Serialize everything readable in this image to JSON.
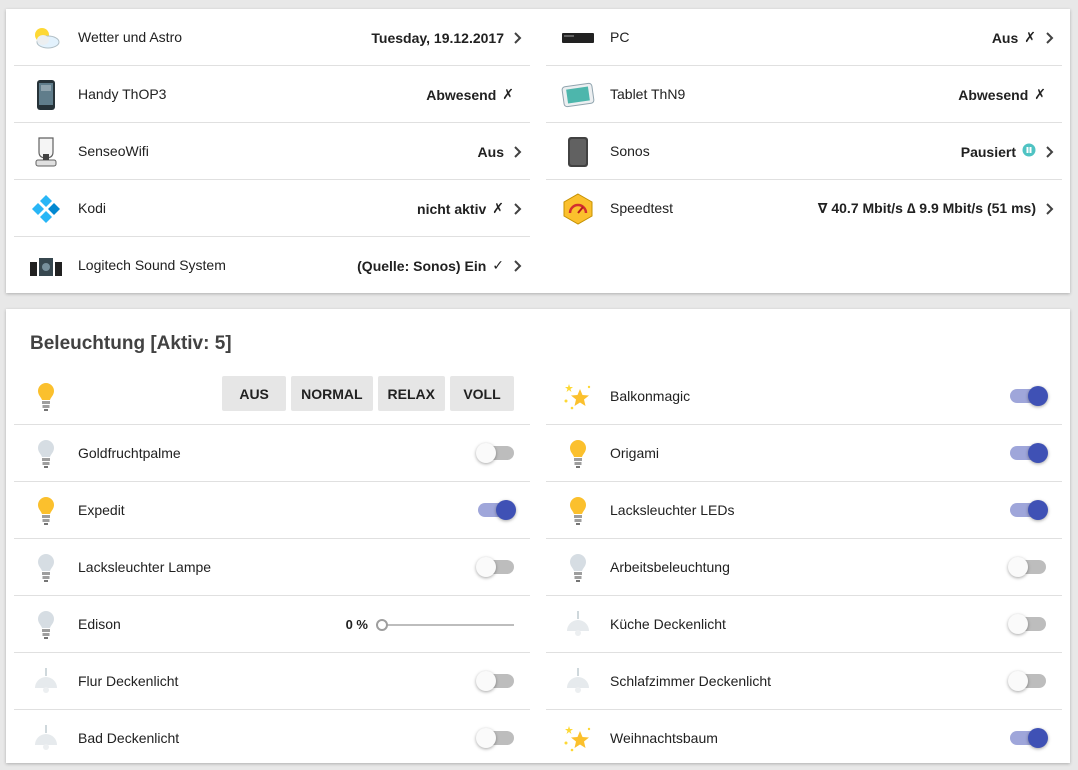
{
  "devices": {
    "left": [
      {
        "name": "Wetter und Astro",
        "value": "Tuesday, 19.12.2017",
        "symbol": "",
        "chevron": true,
        "icon": "weather-icon"
      },
      {
        "name": "Handy ThOP3",
        "value": "Abwesend",
        "symbol": "✗",
        "chevron": false,
        "icon": "phone-icon"
      },
      {
        "name": "SenseoWifi",
        "value": "Aus",
        "symbol": "",
        "chevron": true,
        "icon": "coffee-machine-icon"
      },
      {
        "name": "Kodi",
        "value": "nicht aktiv",
        "symbol": "✗",
        "chevron": true,
        "icon": "kodi-icon"
      },
      {
        "name": "Logitech Sound System",
        "value": "(Quelle: Sonos)  Ein",
        "symbol": "✓",
        "chevron": true,
        "icon": "speaker-system-icon"
      }
    ],
    "right": [
      {
        "name": "PC",
        "value": "Aus",
        "symbol": "✗",
        "chevron": true,
        "icon": "pc-icon"
      },
      {
        "name": "Tablet ThN9",
        "value": "Abwesend",
        "symbol": "✗",
        "chevron": false,
        "icon": "tablet-icon"
      },
      {
        "name": "Sonos",
        "value": "Pausiert",
        "symbol": "pause",
        "chevron": true,
        "icon": "sonos-speaker-icon"
      },
      {
        "name": "Speedtest",
        "value": "∇ 40.7 Mbit/s ∆ 9.9 Mbit/s (51 ms)",
        "symbol": "",
        "chevron": true,
        "icon": "speedtest-icon"
      }
    ]
  },
  "lights": {
    "title": "Beleuchtung [Aktiv: 5]",
    "scenes": [
      "AUS",
      "NORMAL",
      "RELAX",
      "VOLL"
    ],
    "left": [
      {
        "name": "Goldfruchtpalme",
        "on": false,
        "icon": "bulb-icon"
      },
      {
        "name": "Expedit",
        "on": true,
        "icon": "bulb-icon"
      },
      {
        "name": "Lacksleuchter Lampe",
        "on": false,
        "icon": "bulb-icon"
      },
      {
        "name": "Edison",
        "slider": true,
        "value_label": "0 %",
        "level": 0,
        "icon": "bulb-icon"
      },
      {
        "name": "Flur Deckenlicht",
        "on": false,
        "icon": "ceiling-lamp-icon"
      },
      {
        "name": "Bad Deckenlicht",
        "on": false,
        "icon": "ceiling-lamp-icon"
      }
    ],
    "right": [
      {
        "name": "Balkonmagic",
        "on": true,
        "icon": "stars-icon"
      },
      {
        "name": "Origami",
        "on": true,
        "icon": "bulb-icon"
      },
      {
        "name": "Lacksleuchter LEDs",
        "on": true,
        "icon": "bulb-icon"
      },
      {
        "name": "Arbeitsbeleuchtung",
        "on": false,
        "icon": "bulb-icon"
      },
      {
        "name": "Küche Deckenlicht",
        "on": false,
        "icon": "ceiling-lamp-icon"
      },
      {
        "name": "Schlafzimmer Deckenlicht",
        "on": false,
        "icon": "ceiling-lamp-icon"
      },
      {
        "name": "Weihnachtsbaum",
        "on": true,
        "icon": "stars-icon"
      }
    ]
  },
  "colors": {
    "accent": "#3f51b5",
    "bulb_on": "#fbc02d",
    "bulb_off": "#d6dde3",
    "sonos_pause": "#4fc3c3"
  }
}
